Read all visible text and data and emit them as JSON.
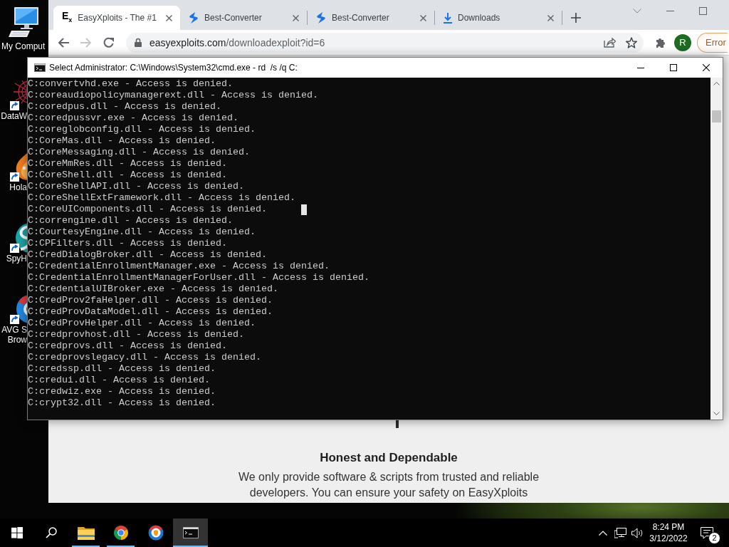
{
  "desktop": {
    "icons": [
      {
        "label": "My Comput",
        "kind": "computer",
        "shortcut": false
      },
      {
        "label": "DataW",
        "kind": "web",
        "shortcut": true
      },
      {
        "label": "Hola",
        "kind": "flame",
        "shortcut": true
      },
      {
        "label": "SpyH",
        "kind": "swirl",
        "shortcut": true
      },
      {
        "label": "AVG S Brow",
        "kind": "ring",
        "shortcut": true
      }
    ]
  },
  "browser": {
    "tabs": [
      {
        "kind": "text-logo",
        "logo": "E$_{x}$",
        "title": "EasyXploits - The #1",
        "selected": true
      },
      {
        "kind": "swoosh",
        "title": "Best-Converter",
        "selected": false
      },
      {
        "kind": "swoosh",
        "title": "Best-Converter",
        "selected": false
      },
      {
        "kind": "download",
        "title": "Downloads",
        "selected": false
      }
    ],
    "toolbar": {
      "nav": [
        {
          "kind": "back",
          "disabled": false
        },
        {
          "kind": "forward",
          "disabled": true
        },
        {
          "kind": "reload",
          "disabled": false
        }
      ],
      "url_host": "easyexploits.com",
      "url_path": "/downloadexploit?id=6",
      "avatar": "R",
      "status_chip": "Error"
    },
    "page": {
      "heading": "Honest and Dependable",
      "paragraph": "We only provide software & scripts from trusted and reliable developers. You can ensure your safety on EasyXploits"
    }
  },
  "cmd": {
    "title": "Select Administrator: C:\\Windows\\System32\\cmd.exe - rd  /s /q C:",
    "lines": [
      {
        "text": "C:convertvhd.exe - Access is denied.",
        "cursor": false
      },
      {
        "text": "C:coreaudiopolicymanagerext.dll - Access is denied.",
        "cursor": false
      },
      {
        "text": "C:coredpus.dll - Access is denied.",
        "cursor": false
      },
      {
        "text": "C:coredpussvr.exe - Access is denied.",
        "cursor": false
      },
      {
        "text": "C:coreglobconfig.dll - Access is denied.",
        "cursor": false
      },
      {
        "text": "C:CoreMas.dll - Access is denied.",
        "cursor": false
      },
      {
        "text": "C:CoreMessaging.dll - Access is denied.",
        "cursor": false
      },
      {
        "text": "C:CoreMmRes.dll - Access is denied.",
        "cursor": false
      },
      {
        "text": "C:CoreShell.dll - Access is denied.",
        "cursor": false
      },
      {
        "text": "C:CoreShellAPI.dll - Access is denied.",
        "cursor": false
      },
      {
        "text": "C:CoreShellExtFramework.dll - Access is denied.",
        "cursor": false
      },
      {
        "text": "C:CoreUIComponents.dll - Access is denied.",
        "cursor": true
      },
      {
        "text": "C:correngine.dll - Access is denied.",
        "cursor": false
      },
      {
        "text": "C:CourtesyEngine.dll - Access is denied.",
        "cursor": false
      },
      {
        "text": "C:CPFilters.dll - Access is denied.",
        "cursor": false
      },
      {
        "text": "C:CredDialogBroker.dll - Access is denied.",
        "cursor": false
      },
      {
        "text": "C:CredentialEnrollmentManager.exe - Access is denied.",
        "cursor": false
      },
      {
        "text": "C:CredentialEnrollmentManagerForUser.dll - Access is denied.",
        "cursor": false
      },
      {
        "text": "C:CredentialUIBroker.exe - Access is denied.",
        "cursor": false
      },
      {
        "text": "C:CredProv2faHelper.dll - Access is denied.",
        "cursor": false
      },
      {
        "text": "C:CredProvDataModel.dll - Access is denied.",
        "cursor": false
      },
      {
        "text": "C:CredProvHelper.dll - Access is denied.",
        "cursor": false
      },
      {
        "text": "C:credprovhost.dll - Access is denied.",
        "cursor": false
      },
      {
        "text": "C:credprovs.dll - Access is denied.",
        "cursor": false
      },
      {
        "text": "C:credprovslegacy.dll - Access is denied.",
        "cursor": false
      },
      {
        "text": "C:credssp.dll - Access is denied.",
        "cursor": false
      },
      {
        "text": "C:credui.dll - Access is denied.",
        "cursor": false
      },
      {
        "text": "C:credwiz.exe - Access is denied.",
        "cursor": false
      },
      {
        "text": "C:crypt32.dll - Access is denied.",
        "cursor": false
      }
    ]
  },
  "taskbar": {
    "apps": [
      {
        "kind": "explorer",
        "running": true,
        "selected": false
      },
      {
        "kind": "chrome",
        "running": true,
        "selected": false
      },
      {
        "kind": "secure-browser",
        "running": false,
        "selected": false
      },
      {
        "kind": "terminal",
        "running": true,
        "selected": true
      }
    ],
    "clock": {
      "time": "8:24 PM",
      "date": "3/12/2022"
    },
    "notification_count": "2"
  }
}
